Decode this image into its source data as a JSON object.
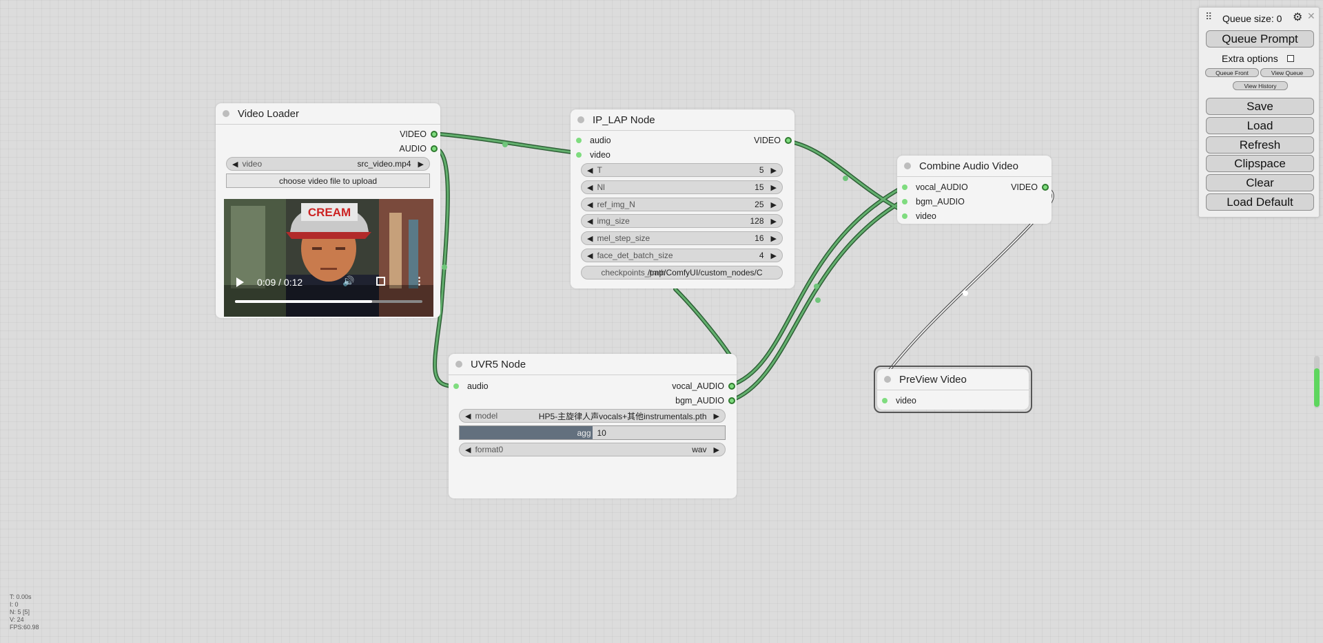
{
  "nodes": {
    "video_loader": {
      "title": "Video Loader",
      "outputs": [
        "VIDEO",
        "AUDIO"
      ],
      "video_widget": {
        "label": "video",
        "value": "src_video.mp4"
      },
      "upload_button": "choose video file to upload",
      "player": {
        "time": "0:09 / 0:12",
        "progress": 0.73,
        "cap_text": "CREAM"
      }
    },
    "ip_lap": {
      "title": "IP_LAP Node",
      "inputs": [
        "audio",
        "video"
      ],
      "outputs": [
        "VIDEO"
      ],
      "widgets": [
        {
          "label": "T",
          "value": "5"
        },
        {
          "label": "Nl",
          "value": "15"
        },
        {
          "label": "ref_img_N",
          "value": "25"
        },
        {
          "label": "img_size",
          "value": "128"
        },
        {
          "label": "mel_step_size",
          "value": "16"
        },
        {
          "label": "face_det_batch_size",
          "value": "4"
        }
      ],
      "checkpoints": {
        "label": "checkpoints_path",
        "value": "/tmp/ComfyUI/custom_nodes/C"
      }
    },
    "uvr5": {
      "title": "UVR5 Node",
      "inputs": [
        "audio"
      ],
      "outputs": [
        "vocal_AUDIO",
        "bgm_AUDIO"
      ],
      "model": {
        "label": "model",
        "value": "HP5-主旋律人声vocals+其他instrumentals.pth"
      },
      "agg": {
        "label": "agg",
        "value": "10",
        "fraction": 0.5
      },
      "format": {
        "label": "format0",
        "value": "wav"
      }
    },
    "combine": {
      "title": "Combine Audio Video",
      "inputs": [
        "vocal_AUDIO",
        "bgm_AUDIO",
        "video"
      ],
      "outputs": [
        "VIDEO"
      ]
    },
    "preview": {
      "title": "PreView Video",
      "inputs": [
        "video"
      ]
    }
  },
  "panel": {
    "queue_size": "Queue size: 0",
    "queue_prompt": "Queue Prompt",
    "extra_options": "Extra options",
    "queue_front": "Queue Front",
    "view_queue": "View Queue",
    "view_history": "View History",
    "save": "Save",
    "load": "Load",
    "refresh": "Refresh",
    "clipspace": "Clipspace",
    "clear": "Clear",
    "load_default": "Load Default"
  },
  "stats": [
    "T: 0.00s",
    "I: 0",
    "N: 5 [5]",
    "V: 24",
    "FPS:60.98"
  ],
  "colors": {
    "wire": "#4f9a5c",
    "slot": "#7fdc7f",
    "accent_bar": "#5ed65e"
  }
}
